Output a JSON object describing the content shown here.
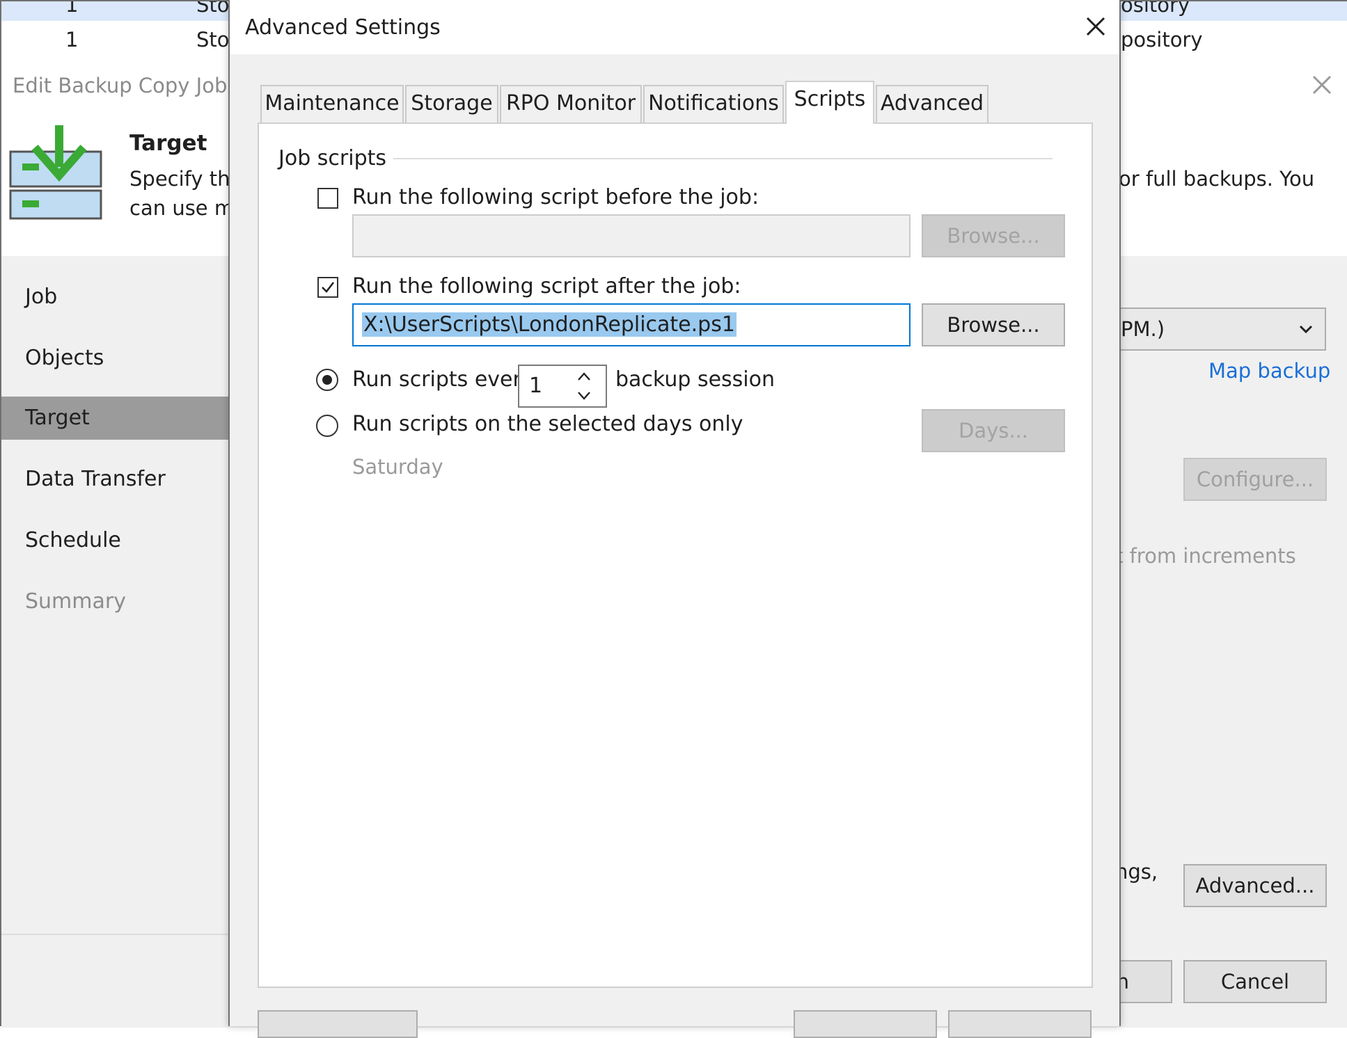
{
  "background": {
    "grid_rows": [
      {
        "num": "1",
        "name": "Sto",
        "repo": "ository"
      },
      {
        "num": "1",
        "name": "Sto",
        "repo": "pository"
      }
    ],
    "wizard_title": "Edit Backup Copy Job I",
    "header": {
      "heading": "Target",
      "desc_line1": "Specify the",
      "desc_line2": "can use ma",
      "desc_right": "or full backups. You"
    },
    "steps": [
      {
        "label": "Job",
        "state": "normal"
      },
      {
        "label": "Objects",
        "state": "normal"
      },
      {
        "label": "Target",
        "state": "active"
      },
      {
        "label": "Data Transfer",
        "state": "normal"
      },
      {
        "label": "Schedule",
        "state": "normal"
      },
      {
        "label": "Summary",
        "state": "disabled"
      }
    ],
    "select_value": "PM.)",
    "map_backup_link": "Map backup",
    "configure_button": "Configure...",
    "faded_text": "t from increments",
    "ngs_text": "ngs,",
    "advanced_button": "Advanced...",
    "finish_button_fragment": "h",
    "cancel_button": "Cancel"
  },
  "dialog": {
    "title": "Advanced Settings",
    "tabs": [
      {
        "label": "Maintenance",
        "active": false
      },
      {
        "label": "Storage",
        "active": false
      },
      {
        "label": "RPO Monitor",
        "active": false
      },
      {
        "label": "Notifications",
        "active": false
      },
      {
        "label": "Scripts",
        "active": true
      },
      {
        "label": "Advanced",
        "active": false
      }
    ],
    "group_label": "Job scripts",
    "before_script": {
      "label": "Run the following script before the job:",
      "checked": false,
      "value": "",
      "browse_label": "Browse..."
    },
    "after_script": {
      "label": "Run the following script after the job:",
      "checked": true,
      "value": "X:\\UserScripts\\LondonReplicate.ps1",
      "browse_label": "Browse..."
    },
    "run_every": {
      "label_prefix": "Run scripts every",
      "value": "1",
      "label_suffix": "backup session",
      "selected": true
    },
    "run_days": {
      "label": "Run scripts on the selected days only",
      "selected": false,
      "days_button": "Days...",
      "days_summary": "Saturday"
    }
  },
  "colors": {
    "accent_blue": "#0078d7",
    "link_blue": "#1a6fd6",
    "selection": "#99c9ef",
    "icon_green": "#3aaa35",
    "icon_blue": "#bfdcf3"
  },
  "icons": [
    "close-icon",
    "target-step-icon",
    "chevron-down-icon",
    "checkbox-icon",
    "radio-icon",
    "spin-up-icon",
    "spin-down-icon"
  ]
}
